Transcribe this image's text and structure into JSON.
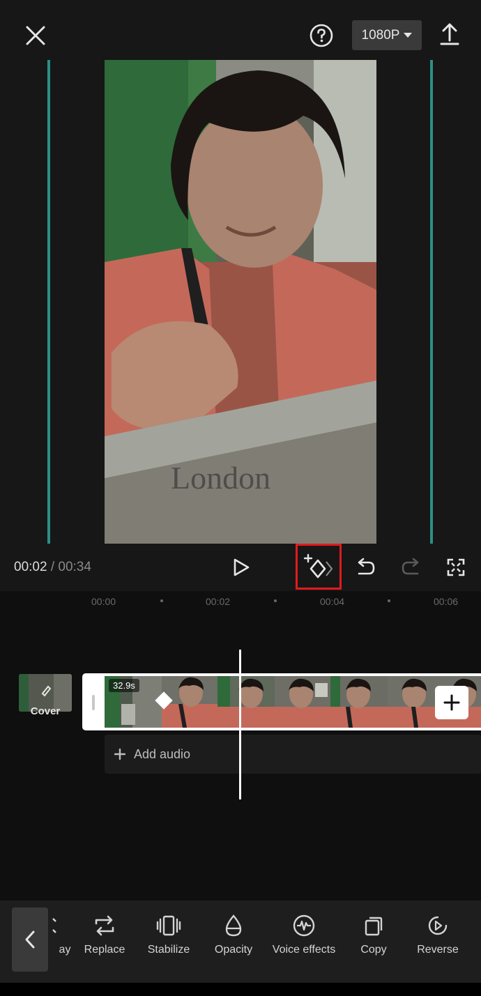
{
  "header": {
    "close_icon": "close-icon",
    "help_icon": "help-icon",
    "resolution": "1080P",
    "export_icon": "export-icon"
  },
  "playback": {
    "current_time": "00:02",
    "separator": " / ",
    "total_time": "00:34"
  },
  "ruler": {
    "ticks": [
      "00:00",
      "00:02",
      "00:04",
      "00:06"
    ]
  },
  "timeline": {
    "cover_label": "Cover",
    "clip_duration": "32.9s",
    "add_audio_label": "Add audio"
  },
  "toolbar": {
    "partial_label": "ay",
    "items": [
      {
        "label": "Replace",
        "icon": "replace-icon"
      },
      {
        "label": "Stabilize",
        "icon": "stabilize-icon"
      },
      {
        "label": "Opacity",
        "icon": "opacity-icon"
      },
      {
        "label": "Voice effects",
        "icon": "voice-effects-icon"
      },
      {
        "label": "Copy",
        "icon": "copy-icon"
      },
      {
        "label": "Reverse",
        "icon": "reverse-icon"
      }
    ]
  },
  "colors": {
    "guide_line": "#2c8f85",
    "highlight_box": "#e01b1b",
    "background": "#101010"
  }
}
